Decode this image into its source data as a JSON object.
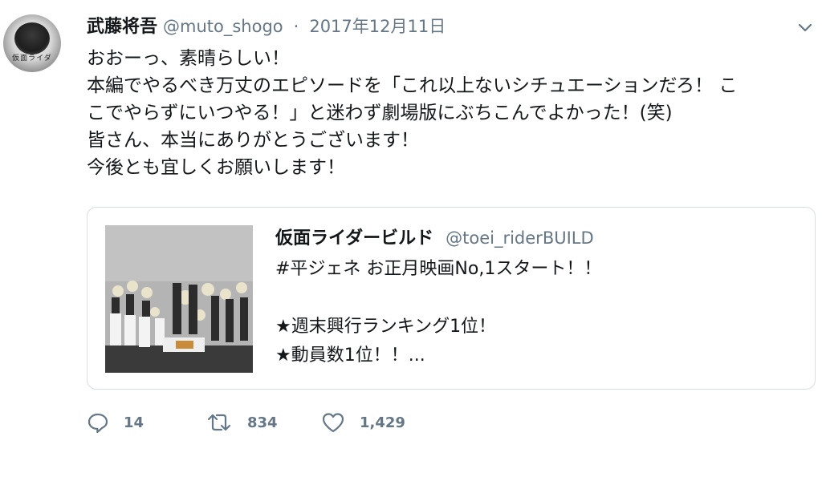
{
  "author": {
    "display_name": "武藤将吾",
    "handle": "@muto_shogo",
    "separator": "·",
    "date": "2017年12月11日",
    "avatar_text": "仮面ライダ"
  },
  "tweet": {
    "lines": [
      "おおーっ、素晴らしい！",
      "本編でやるべき万丈のエピソードを「これ以上ないシチュエーションだろ！ こ",
      "こでやらずにいつやる！」と迷わず劇場版にぶちこんでよかった！(笑)",
      "皆さん、本当にありがとうございます！",
      "今後とも宜しくお願いします！"
    ]
  },
  "quoted": {
    "display_name": "仮面ライダービルド",
    "handle": "@toei_riderBUILD",
    "lines": [
      "#平ジェネ お正月映画No,1スタート！！",
      "",
      "★週末興行ランキング1位！",
      "★動員数1位！！..."
    ]
  },
  "actions": {
    "replies": "14",
    "retweets": "834",
    "likes": "1,429"
  },
  "colors": {
    "text": "#14171a",
    "secondary": "#657786",
    "border": "#d8dee2"
  },
  "icons": {
    "menu": "chevron-down-icon",
    "reply": "reply-icon",
    "retweet": "retweet-icon",
    "like": "heart-icon"
  }
}
